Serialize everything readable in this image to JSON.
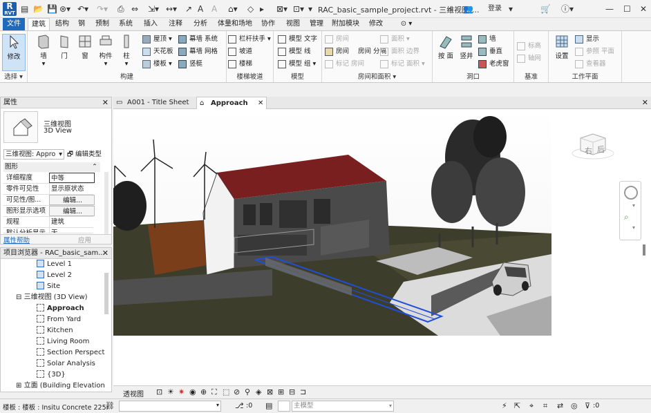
{
  "app": {
    "logo_letter": "R",
    "logo_sub": "RVT",
    "document_title": "RAC_basic_sample_project.rvt - 三维视图:...",
    "sign_in": "登录",
    "help_icon": "question-icon",
    "window_controls": [
      "minimize-icon",
      "maximize-icon",
      "close-icon"
    ]
  },
  "ribbon_tabs": [
    {
      "label": "文件",
      "state": "file"
    },
    {
      "label": "建筑",
      "state": "active"
    },
    {
      "label": "结构"
    },
    {
      "label": "钢"
    },
    {
      "label": "预制"
    },
    {
      "label": "系统"
    },
    {
      "label": "插入"
    },
    {
      "label": "注释"
    },
    {
      "label": "分析"
    },
    {
      "label": "体量和场地"
    },
    {
      "label": "协作"
    },
    {
      "label": "视图"
    },
    {
      "label": "管理"
    },
    {
      "label": "附加模块"
    },
    {
      "label": "修改"
    },
    {
      "label": "⊙ ▾"
    }
  ],
  "ribbon": {
    "select": {
      "modify": "修改",
      "panel": "选择 ▾"
    },
    "build": {
      "wall": "墙",
      "door": "门",
      "window": "窗",
      "component": "构件",
      "column": "柱",
      "roof": "屋顶",
      "ceiling": "天花板",
      "floor": "楼板",
      "curtain_system": "幕墙 系统",
      "curtain_grid": "幕墙 网格",
      "mullion": "竖梃",
      "panel": "构建"
    },
    "circulation": {
      "railing": "栏杆扶手",
      "ramp": "坡道",
      "stair": "楼梯",
      "panel": "楼梯坡道"
    },
    "model": {
      "text": "模型 文字",
      "line": "模型 线",
      "group": "模型 组",
      "panel": "模型"
    },
    "room": {
      "room": "房间",
      "separator": "房间 分隔",
      "room_tag": "标记 房间",
      "area": "面积",
      "area_boundary": "面积 边界",
      "area_tag": "标记 面积",
      "room_top": "房间",
      "panel": "房间和面积 ▾"
    },
    "opening": {
      "by_face": "按 面",
      "shaft": "竖井",
      "wall": "墙",
      "vertical": "垂直",
      "dormer": "老虎窗",
      "panel": "洞口"
    },
    "datum": {
      "level": "标高",
      "grid": "轴网",
      "panel": "基准"
    },
    "workplane": {
      "set": "设置",
      "show": "显示",
      "ref_plane": "参照 平面",
      "viewer": "查看器",
      "panel": "工作平面"
    }
  },
  "properties": {
    "title": "属性",
    "type_name": "三维视图",
    "type_sub": "3D View",
    "selector": "三维视图: Appro",
    "edit_type": "编辑类型",
    "category": "图形",
    "rows": [
      {
        "key": "详细程度",
        "value": "中等"
      },
      {
        "key": "零件可见性",
        "value": "显示原状态"
      },
      {
        "key": "可见性/图...",
        "value": "编辑..."
      },
      {
        "key": "图形显示选项",
        "value": "编辑..."
      },
      {
        "key": "规程",
        "value": "建筑"
      },
      {
        "key": "默认分析显示...",
        "value": "无"
      }
    ],
    "help": "属性帮助",
    "apply": "应用"
  },
  "browser": {
    "title": "项目浏览器 - RAC_basic_sam...",
    "items": [
      {
        "label": "Level 1",
        "kind": "plan",
        "indent": 3
      },
      {
        "label": "Level 2",
        "kind": "plan",
        "indent": 3
      },
      {
        "label": "Site",
        "kind": "plan",
        "indent": 3
      },
      {
        "label": "三维视图 (3D View)",
        "kind": "group",
        "indent": 2,
        "expander": "⊟"
      },
      {
        "label": "Approach",
        "kind": "3d",
        "indent": 3,
        "bold": true
      },
      {
        "label": "From Yard",
        "kind": "3d",
        "indent": 3
      },
      {
        "label": "Kitchen",
        "kind": "3d",
        "indent": 3
      },
      {
        "label": "Living Room",
        "kind": "3d",
        "indent": 3
      },
      {
        "label": "Section Perspect",
        "kind": "3d",
        "indent": 3
      },
      {
        "label": "Solar Analysis",
        "kind": "3d",
        "indent": 3
      },
      {
        "label": "{3D}",
        "kind": "3d",
        "indent": 3
      },
      {
        "label": "立面 (Building Elevation",
        "kind": "group",
        "indent": 2,
        "expander": "⊞"
      }
    ]
  },
  "view_tabs": [
    {
      "label": "A001 - Title Sheet",
      "active": false
    },
    {
      "label": "Approach",
      "active": true
    }
  ],
  "viewcube": {
    "left": "右",
    "front": "后"
  },
  "view_control_bar": {
    "label": "透视图"
  },
  "status": {
    "text": "楼板 : 楼板 : Insitu Concrete 225r",
    "zero1": ":0",
    "model": "主模型",
    "zero2": ":0"
  },
  "colors": {
    "accent": "#1e6bbd",
    "selection": "#1f4fd6",
    "roof": "#7a1f1f"
  }
}
